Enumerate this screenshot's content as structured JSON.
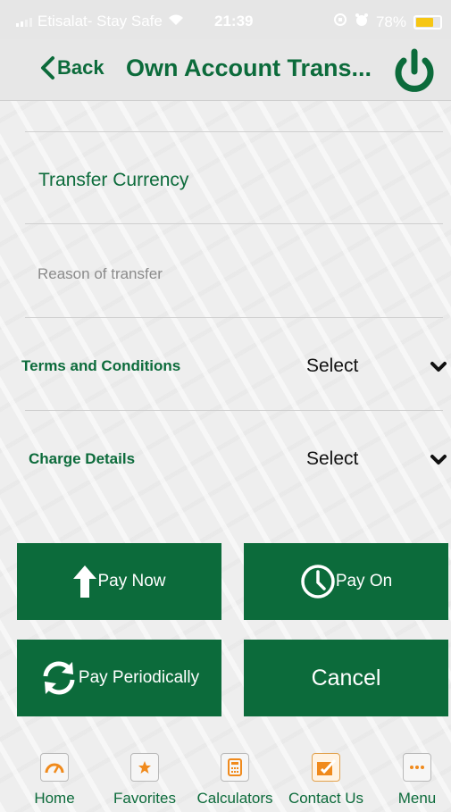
{
  "status_bar": {
    "carrier": "Etisalat- Stay Safe",
    "time": "21:39",
    "battery": "78%",
    "battery_level": 0.78
  },
  "header": {
    "back_label": "Back",
    "title": "Own Account Trans..."
  },
  "form": {
    "transfer_currency_label": "Transfer Currency",
    "reason_placeholder": "Reason of transfer",
    "terms_label": "Terms and Conditions",
    "terms_value": "Select",
    "charge_label": "Charge Details",
    "charge_value": "Select"
  },
  "actions": {
    "pay_now": "Pay Now",
    "pay_on": "Pay On",
    "pay_periodically": "Pay Periodically",
    "cancel": "Cancel"
  },
  "tabbar": {
    "items": [
      {
        "label": "Home",
        "icon": "speedometer-icon"
      },
      {
        "label": "Favorites",
        "icon": "star-icon"
      },
      {
        "label": "Calculators",
        "icon": "calculator-icon"
      },
      {
        "label": "Contact Us",
        "icon": "contact-edit-icon"
      },
      {
        "label": "Menu",
        "icon": "more-dots-icon"
      }
    ]
  },
  "colors": {
    "brand_green": "#0c6b3b",
    "accent_orange": "#f08a1c",
    "battery_yellow": "#f6c613"
  }
}
